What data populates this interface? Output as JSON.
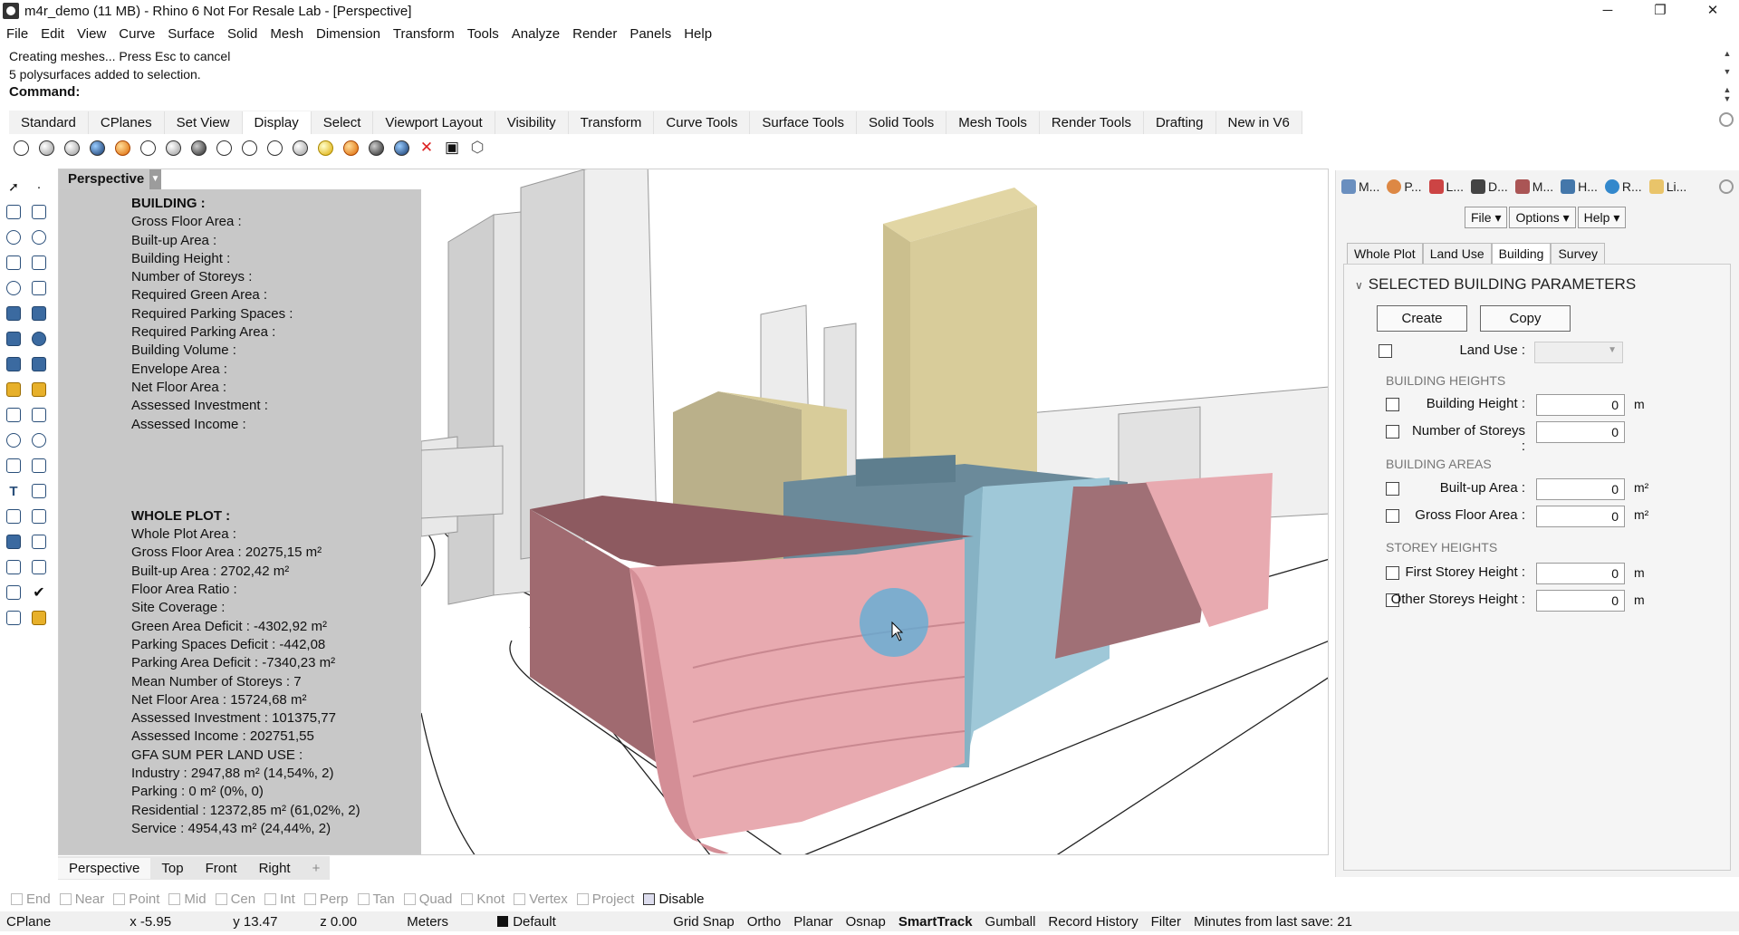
{
  "window": {
    "title": "m4r_demo (11 MB) - Rhino 6 Not For Resale Lab - [Perspective]",
    "minimize": "─",
    "maximize": "❐",
    "close": "✕"
  },
  "menu": [
    "File",
    "Edit",
    "View",
    "Curve",
    "Surface",
    "Solid",
    "Mesh",
    "Dimension",
    "Transform",
    "Tools",
    "Analyze",
    "Render",
    "Panels",
    "Help"
  ],
  "command": {
    "history_1": "Creating meshes... Press Esc to cancel",
    "history_2": "5 polysurfaces added to selection.",
    "prompt": "Command:"
  },
  "toolbar_tabs": [
    "Standard",
    "CPlanes",
    "Set View",
    "Display",
    "Select",
    "Viewport Layout",
    "Visibility",
    "Transform",
    "Curve Tools",
    "Surface Tools",
    "Solid Tools",
    "Mesh Tools",
    "Render Tools",
    "Drafting",
    "New in V6"
  ],
  "active_toolbar_tab": "Display",
  "viewport": {
    "name": "Perspective",
    "building_header": "BUILDING :",
    "building_lines": [
      "Gross Floor Area :",
      "Built-up Area :",
      "Building Height :",
      "Number of Storeys :",
      "Required Green Area :",
      "Required Parking Spaces :",
      "Required Parking Area :",
      "Building Volume :",
      "Envelope Area :",
      "Net Floor Area :",
      "Assessed Investment :",
      "Assessed Income :"
    ],
    "plot_header": "WHOLE PLOT :",
    "plot_lines": [
      "Whole Plot Area :",
      "Gross Floor Area : 20275,15 m²",
      "Built-up Area : 2702,42 m²",
      "Floor Area Ratio :",
      "Site Coverage :",
      "Green Area Deficit : -4302,92 m²",
      "Parking Spaces Deficit : -442,08",
      "Parking Area Deficit : -7340,23 m²",
      "Mean Number of Storeys : 7",
      "Net Floor Area : 15724,68 m²",
      "Assessed Investment : 101375,77",
      "Assessed Income : 202751,55",
      "GFA SUM PER LAND USE :",
      "Industry : 2947,88 m² (14,54%, 2)",
      "Parking : 0 m² (0%, 0)",
      "Residential : 12372,85 m² (61,02%, 2)",
      "Service : 4954,43 m² (24,44%, 2)"
    ]
  },
  "viewport_tabs": [
    "Perspective",
    "Top",
    "Front",
    "Right",
    "+"
  ],
  "right_panel": {
    "tabs": [
      "M...",
      "P...",
      "L...",
      "D...",
      "M...",
      "H...",
      "R...",
      "Li..."
    ],
    "menus": [
      "File ▾",
      "Options ▾",
      "Help ▾"
    ],
    "subtabs": [
      "Whole Plot",
      "Land Use",
      "Building",
      "Survey"
    ],
    "active_subtab": "Building",
    "section_title": "SELECTED BUILDING PARAMETERS",
    "create_label": "Create",
    "copy_label": "Copy",
    "land_use_label": "Land Use :",
    "heights_header": "BUILDING HEIGHTS",
    "building_height_label": "Building Height :",
    "building_height_value": "0",
    "storeys_label": "Number of Storeys :",
    "storeys_value": "0",
    "areas_header": "BUILDING AREAS",
    "builtup_label": "Built-up Area :",
    "builtup_value": "0",
    "gfa_label": "Gross Floor Area :",
    "gfa_value": "0",
    "storey_heights_header": "STOREY HEIGHTS",
    "first_storey_label": "First Storey Height :",
    "first_storey_value": "0",
    "other_storeys_label": "Other Storeys Height :",
    "other_storeys_value": "0",
    "unit_m": "m",
    "unit_m2": "m²"
  },
  "osnaps": [
    {
      "label": "End",
      "on": false
    },
    {
      "label": "Near",
      "on": false
    },
    {
      "label": "Point",
      "on": false
    },
    {
      "label": "Mid",
      "on": false
    },
    {
      "label": "Cen",
      "on": false
    },
    {
      "label": "Int",
      "on": false
    },
    {
      "label": "Perp",
      "on": false
    },
    {
      "label": "Tan",
      "on": false
    },
    {
      "label": "Quad",
      "on": false
    },
    {
      "label": "Knot",
      "on": false
    },
    {
      "label": "Vertex",
      "on": false
    },
    {
      "label": "Project",
      "on": false
    },
    {
      "label": "Disable",
      "on": true
    }
  ],
  "status": {
    "cplane": "CPlane",
    "x": "x -5.95",
    "y": "y 13.47",
    "z": "z 0.00",
    "units": "Meters",
    "layer": "Default",
    "grid_snap": "Grid Snap",
    "ortho": "Ortho",
    "planar": "Planar",
    "osnap": "Osnap",
    "smarttrack": "SmartTrack",
    "gumball": "Gumball",
    "record_history": "Record History",
    "filter": "Filter",
    "last_save": "Minutes from last save: 21"
  },
  "colors": {
    "residential_pink": "#e8aab0",
    "service_blue": "#9fc8d8",
    "industry_khaki": "#d8cc9a",
    "panel_gray": "#c8c8c8"
  }
}
